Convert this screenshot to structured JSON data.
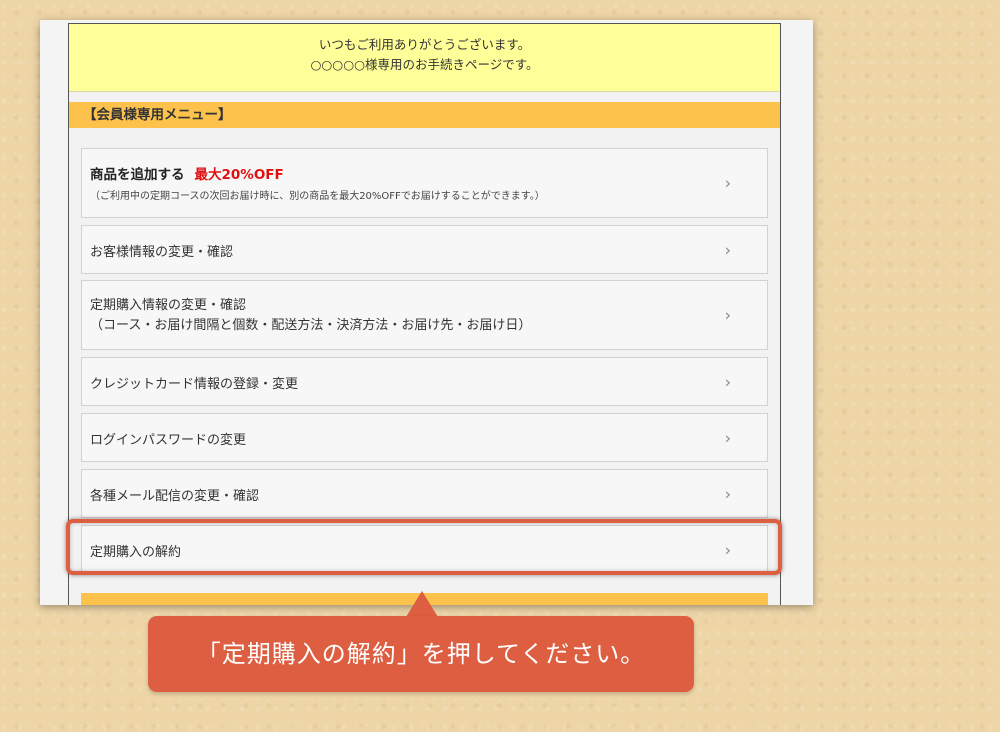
{
  "welcome": {
    "line1": "いつもご利用ありがとうございます。",
    "line2": "○○○○○様専用のお手続きページです。"
  },
  "menu_header": "【会員様専用メニュー】",
  "items": [
    {
      "title": "商品を追加する",
      "badge": "最大20%OFF",
      "note": "（ご利用中の定期コースの次回お届け時に、別の商品を最大20%OFFでお届けすることができます。）"
    },
    {
      "label": "お客様情報の変更・確認"
    },
    {
      "line1": "定期購入情報の変更・確認",
      "line2": "（コース・お届け間隔と個数・配送方法・決済方法・お届け先・お届け日）"
    },
    {
      "label": "クレジットカード情報の登録・変更"
    },
    {
      "label": "ログインパスワードの変更"
    },
    {
      "label": "各種メール配信の変更・確認"
    },
    {
      "label": "定期購入の解約"
    }
  ],
  "chevron": "›",
  "callout": {
    "text": "「定期購入の解約」を押してください。"
  },
  "colors": {
    "background": "#edd5a6",
    "welcome_bg": "#ffff99",
    "menu_header_bg": "#fcc24c",
    "accent": "#dd5e41",
    "badge_red": "#e01010"
  },
  "icons": {
    "chevron": "chevron-right-icon"
  }
}
